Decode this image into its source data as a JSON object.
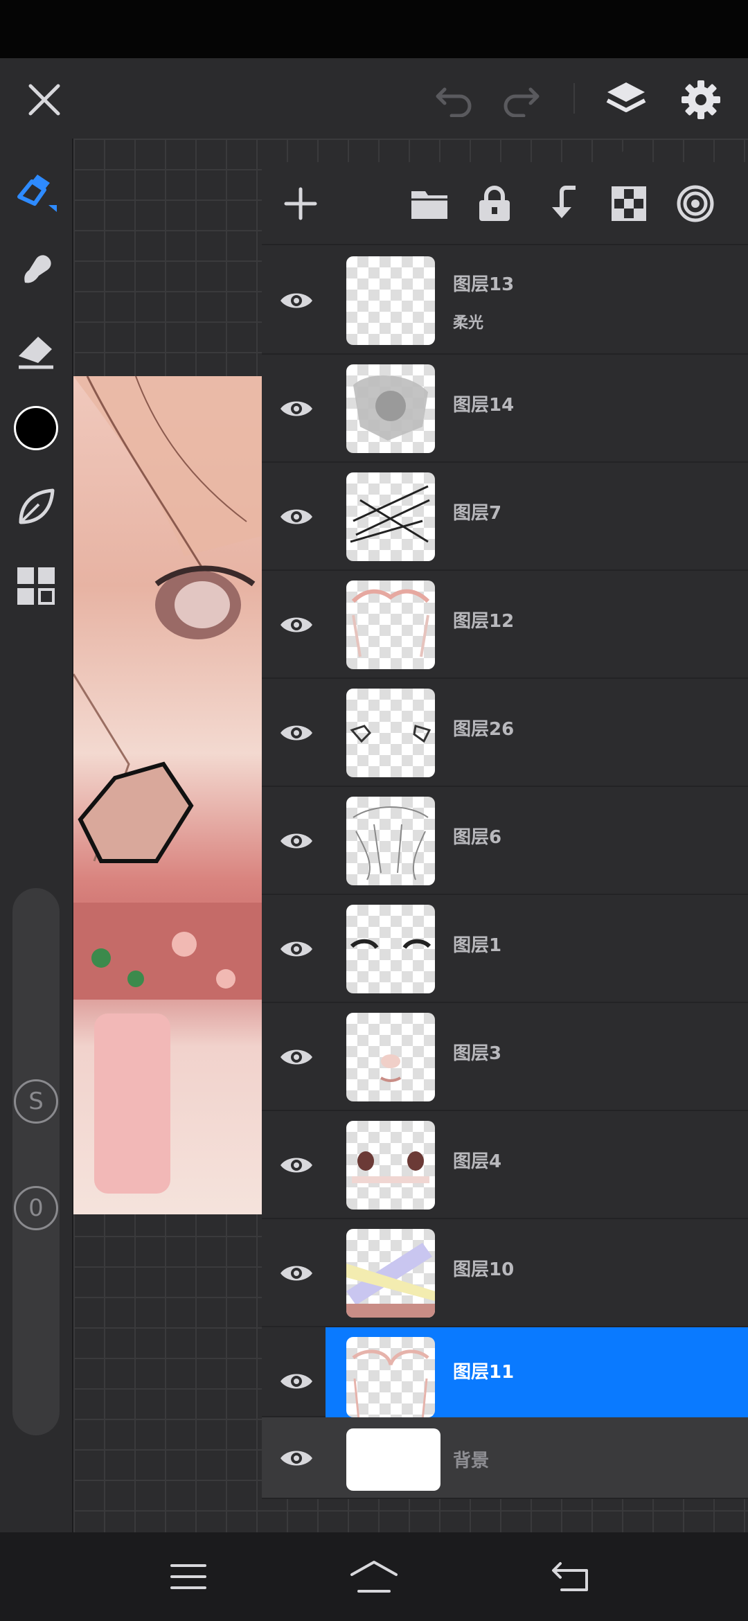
{
  "topbar": {
    "icons": [
      "close-icon",
      "undo-icon",
      "redo-icon",
      "layers-icon",
      "settings-icon"
    ]
  },
  "toolbar": {
    "tools": [
      "pen-icon",
      "smudge-icon",
      "eraser-icon",
      "color-swatch",
      "leaf-icon",
      "grid-menu-icon"
    ],
    "current_color": "#000000",
    "size_label": "S",
    "opacity_label": "0"
  },
  "layers_panel": {
    "tools": [
      "add-icon",
      "folder-icon",
      "lock-icon",
      "merge-down-icon",
      "transparency-icon",
      "target-icon"
    ],
    "layers": [
      {
        "name": "图层13",
        "mode": "柔光",
        "visible": true,
        "selected": false
      },
      {
        "name": "图层14",
        "mode": "",
        "visible": true,
        "selected": false
      },
      {
        "name": "图层7",
        "mode": "",
        "visible": true,
        "selected": false
      },
      {
        "name": "图层12",
        "mode": "",
        "visible": true,
        "selected": false
      },
      {
        "name": "图层26",
        "mode": "",
        "visible": true,
        "selected": false
      },
      {
        "name": "图层6",
        "mode": "",
        "visible": true,
        "selected": false
      },
      {
        "name": "图层1",
        "mode": "",
        "visible": true,
        "selected": false
      },
      {
        "name": "图层3",
        "mode": "",
        "visible": true,
        "selected": false
      },
      {
        "name": "图层4",
        "mode": "",
        "visible": true,
        "selected": false
      },
      {
        "name": "图层10",
        "mode": "",
        "visible": true,
        "selected": false
      },
      {
        "name": "图层11",
        "mode": "",
        "visible": true,
        "selected": true
      }
    ],
    "background_layer": {
      "name": "背景",
      "visible": true
    }
  },
  "navbar": {
    "icons": [
      "menu-icon",
      "home-icon",
      "back-icon"
    ]
  },
  "colors": {
    "accent": "#0a7aff",
    "pen_active": "#2e8bff",
    "panel": "#2c2c2e"
  }
}
